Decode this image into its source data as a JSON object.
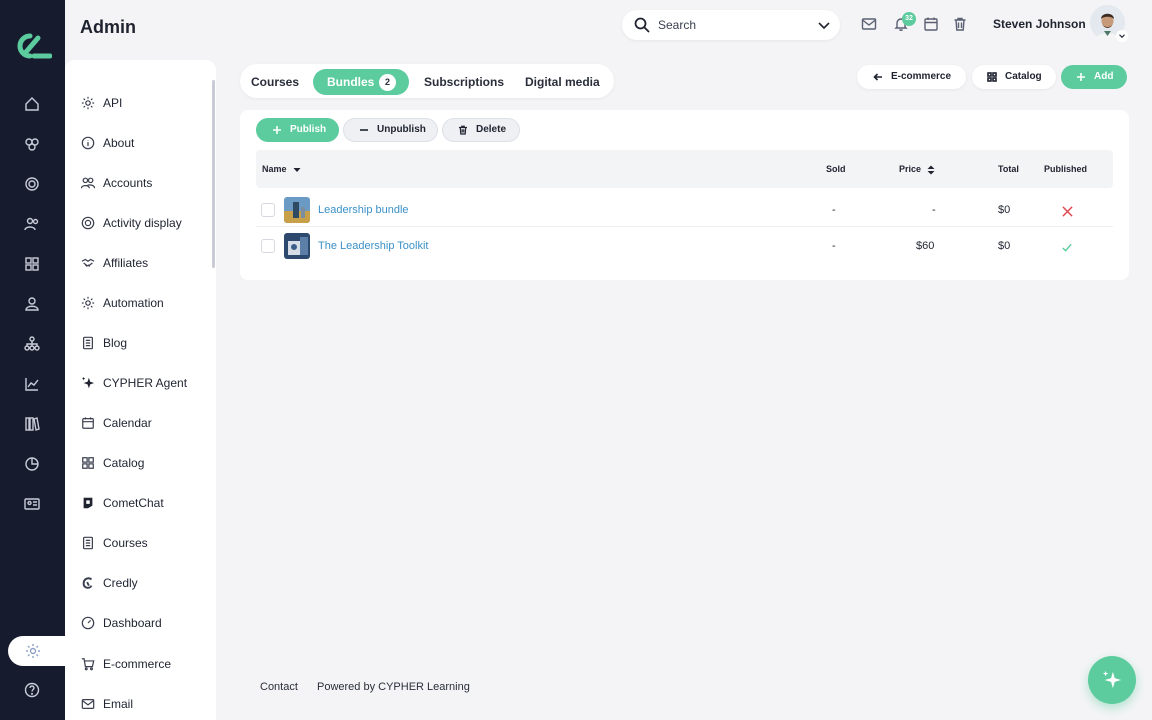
{
  "header": {
    "app_title": "Admin",
    "search_placeholder": "Search",
    "notifications_count": "32",
    "user_name": "Steven Johnson"
  },
  "sidebar": {
    "items": [
      {
        "label": "API",
        "icon": "gear-icon"
      },
      {
        "label": "About",
        "icon": "info-icon"
      },
      {
        "label": "Accounts",
        "icon": "people-icon"
      },
      {
        "label": "Activity display",
        "icon": "target-icon"
      },
      {
        "label": "Affiliates",
        "icon": "handshake-icon"
      },
      {
        "label": "Automation",
        "icon": "gear-icon"
      },
      {
        "label": "Blog",
        "icon": "document-icon"
      },
      {
        "label": "CYPHER Agent",
        "icon": "sparkle-icon"
      },
      {
        "label": "Calendar",
        "icon": "calendar-icon"
      },
      {
        "label": "Catalog",
        "icon": "grid-icon"
      },
      {
        "label": "CometChat",
        "icon": "cometchat-icon"
      },
      {
        "label": "Courses",
        "icon": "document-icon"
      },
      {
        "label": "Credly",
        "icon": "credly-icon"
      },
      {
        "label": "Dashboard",
        "icon": "dashboard-icon"
      },
      {
        "label": "E-commerce",
        "icon": "cart-icon"
      },
      {
        "label": "Email",
        "icon": "mail-icon"
      }
    ]
  },
  "tabs": [
    {
      "label": "Courses"
    },
    {
      "label": "Bundles",
      "count": "2"
    },
    {
      "label": "Subscriptions"
    },
    {
      "label": "Digital media"
    }
  ],
  "top_actions": {
    "ecommerce_label": "E-commerce",
    "catalog_label": "Catalog",
    "add_label": "Add"
  },
  "toolbar": {
    "publish_label": "Publish",
    "unpublish_label": "Unpublish",
    "delete_label": "Delete"
  },
  "table": {
    "columns": {
      "name": "Name",
      "sold": "Sold",
      "price": "Price",
      "total": "Total",
      "published": "Published"
    },
    "rows": [
      {
        "name": "Leadership bundle",
        "sold": "-",
        "price": "-",
        "total": "$0",
        "published": false
      },
      {
        "name": "The Leadership Toolkit",
        "sold": "-",
        "price": "$60",
        "total": "$0",
        "published": true
      }
    ]
  },
  "footer": {
    "contact": "Contact",
    "powered_by": "Powered by CYPHER Learning"
  },
  "colors": {
    "accent": "#5ccc9e",
    "rail": "#171b2e",
    "link": "#3b91c8",
    "error": "#e0474c"
  }
}
